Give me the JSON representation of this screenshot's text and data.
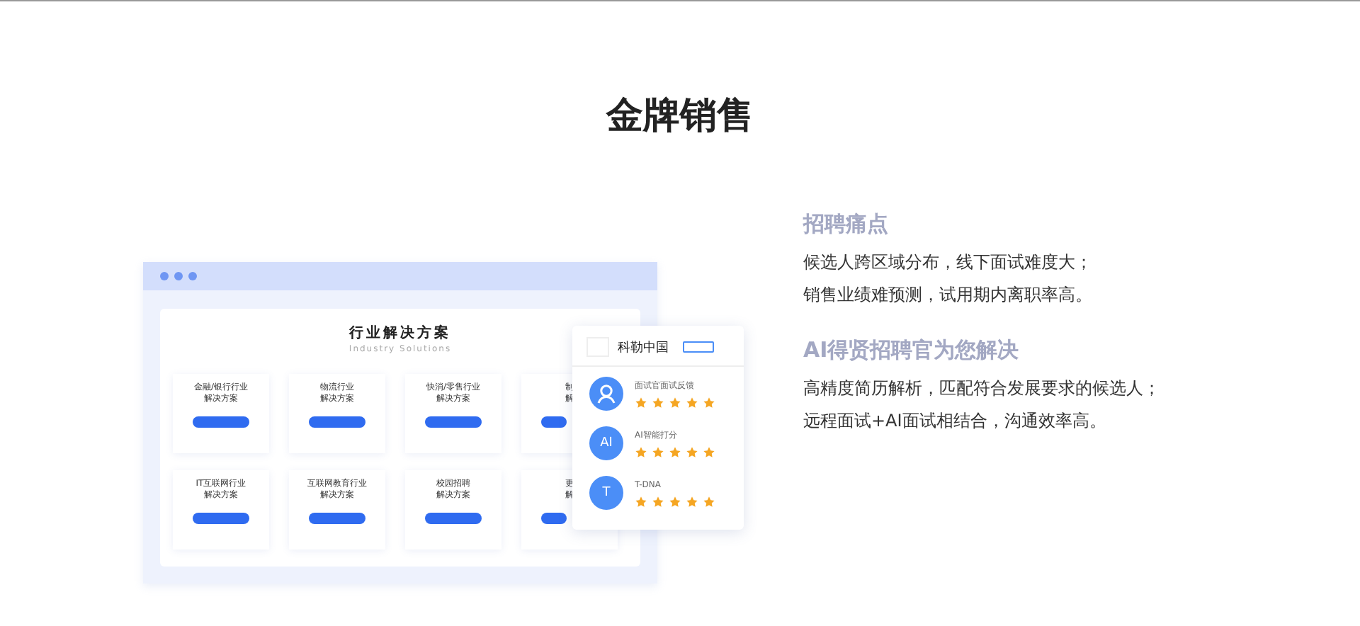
{
  "title": "金牌销售",
  "mockup": {
    "heading": "行业解决方案",
    "subheading": "Industry Solutions",
    "cards": [
      {
        "lines": [
          "金融/银行行业",
          "解决方案"
        ]
      },
      {
        "lines": [
          "物流行业",
          "解决方案"
        ]
      },
      {
        "lines": [
          "快消/零售行业",
          "解决方案"
        ]
      },
      {
        "lines": [
          "制",
          "解"
        ]
      },
      {
        "lines": [
          "IT互联网行业",
          "解决方案"
        ]
      },
      {
        "lines": [
          "互联网教育行业",
          "解决方案"
        ]
      },
      {
        "lines": [
          "校园招聘",
          "解决方案"
        ]
      },
      {
        "lines": [
          "更",
          "解"
        ]
      }
    ]
  },
  "profile": {
    "company": "科勒中国",
    "ratings": [
      {
        "kind": "icon",
        "label": "面试官面试反馈",
        "stars": 5
      },
      {
        "kind": "text",
        "avatar": "AI",
        "label": "AI智能打分",
        "stars": 5
      },
      {
        "kind": "text",
        "avatar": "T",
        "label": "T-DNA",
        "stars": 5
      }
    ]
  },
  "sections": [
    {
      "heading": "招聘痛点",
      "lines": [
        "候选人跨区域分布，线下面试难度大；",
        "销售业绩难预测，试用期内离职率高。"
      ]
    },
    {
      "heading": "AI得贤招聘官为您解决",
      "lines": [
        "高精度简历解析，匹配符合发展要求的候选人；",
        "远程面试+AI面试相结合，沟通效率高。"
      ]
    }
  ]
}
